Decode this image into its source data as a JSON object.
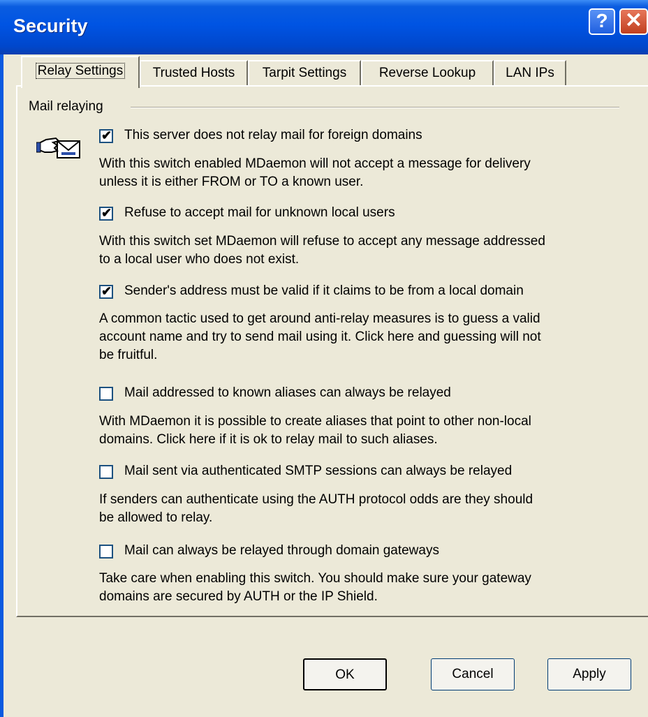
{
  "window": {
    "title": "Security"
  },
  "titlebar": {
    "help_glyph": "?",
    "close_glyph": "✕"
  },
  "tabs": [
    {
      "label": "Relay Settings",
      "active": true
    },
    {
      "label": "Trusted Hosts",
      "active": false
    },
    {
      "label": "Tarpit Settings",
      "active": false
    },
    {
      "label": "Reverse Lookup",
      "active": false
    },
    {
      "label": "LAN IPs",
      "active": false
    }
  ],
  "group": {
    "title": "Mail relaying",
    "icon": "relay-hand-envelope-icon"
  },
  "options": [
    {
      "label": "This server does not relay mail for foreign domains",
      "checked": true,
      "description": "With this switch enabled MDaemon will not accept a message for delivery\nunless it is either FROM or TO a known user."
    },
    {
      "label": "Refuse to accept mail for unknown local users",
      "checked": true,
      "description": "With this switch set MDaemon will refuse to accept any message addressed\nto a local user who does not exist."
    },
    {
      "label": "Sender's address must be valid if it claims to be from a local domain",
      "checked": true,
      "description": "A common tactic used to get around anti-relay measures is to guess a valid\naccount name and try to send mail using it.  Click here and guessing will not\nbe fruitful."
    },
    {
      "label": "Mail addressed to known aliases can always be relayed",
      "checked": false,
      "description": "With MDaemon it is possible to create aliases that point to other non-local\ndomains.  Click here if it is ok to relay mail to such aliases."
    },
    {
      "label": "Mail sent via authenticated SMTP sessions can always be relayed",
      "checked": false,
      "description": "If senders can authenticate using the AUTH protocol odds are they should\nbe allowed to relay."
    },
    {
      "label": "Mail can always be relayed through domain gateways",
      "checked": false,
      "description": "Take care when enabling this switch.  You should make sure your gateway\ndomains are secured by AUTH or the IP Shield."
    }
  ],
  "buttons": {
    "ok": "OK",
    "cancel": "Cancel",
    "apply": "Apply"
  },
  "check_glyph": "✔"
}
